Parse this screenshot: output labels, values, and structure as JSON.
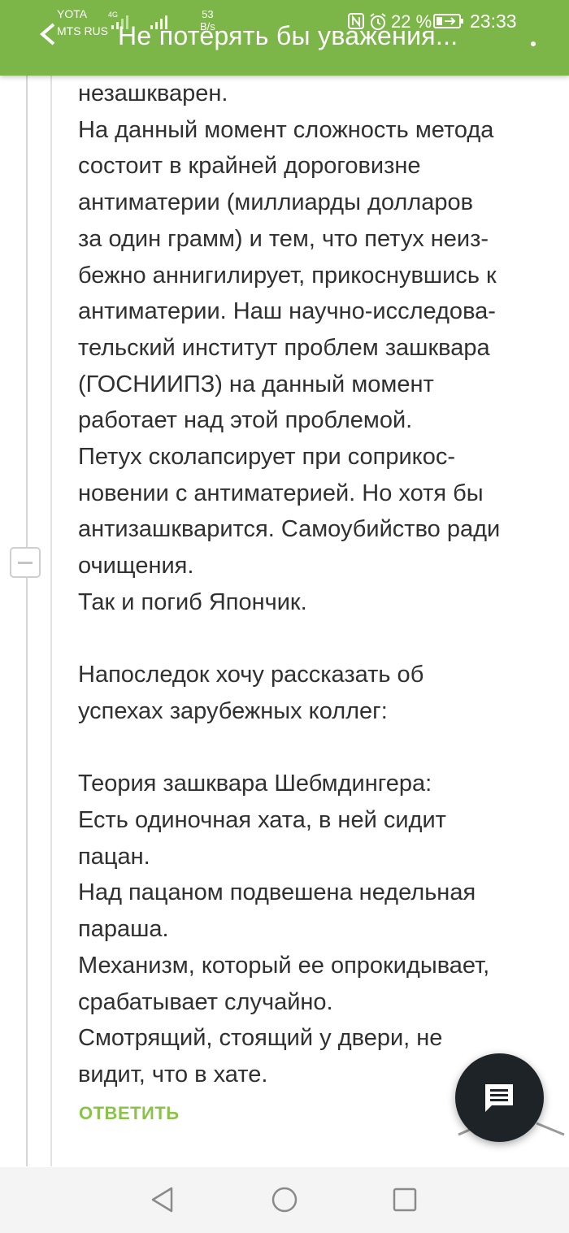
{
  "status_bar": {
    "carrier1": "YOTA",
    "carrier2": "MTS RUS",
    "network1": "4G",
    "speed_value": "53",
    "speed_unit": "B/s",
    "battery": "22 %",
    "time": "23:33"
  },
  "header": {
    "title": "Не потерять бы уважения..."
  },
  "comment": {
    "paragraphs": [
      "незашкварен.",
      "На данный момент сложность метода",
      "состоит в крайней дороговизне",
      "антиматерии (миллиарды долларов",
      "за один грамм) и тем, что петух неиз-",
      "бежно аннигилирует, прикоснувшись к",
      "антиматерии. Наш научно-исследова-",
      "тельский институт проблем зашквара",
      "(ГОСНИИПЗ) на данный момент",
      "работает над этой проблемой.",
      "Петух сколапсирует при соприкос-",
      "новении с антиматерией. Но хотя бы",
      "антизашкварится. Самоубийство ради",
      "очищения.",
      "Так и погиб Япончик.",
      "",
      "Напоследок хочу рассказать об",
      "успехах зарубежных коллег:",
      "",
      "Теория зашквара Шебмдингера:",
      "Есть одиночная хата, в ней сидит",
      "пацан.",
      "Над пацаном подвешена недельная",
      "параша.",
      "Механизм, который ее опрокидывает,",
      "срабатывает случайно.",
      "Смотрящий, стоящий у двери, не",
      "видит, что в хате."
    ],
    "reply_label": "ОТВЕТИТЬ"
  },
  "colors": {
    "accent": "#7cb548",
    "reply": "#8bc34a",
    "fab": "#1e2328",
    "text": "#303030"
  },
  "icons": {
    "fab": "comment-icon",
    "collapse": "minus-icon",
    "nav_back": "triangle-back-icon",
    "nav_home": "circle-home-icon",
    "nav_recent": "square-recent-icon"
  }
}
